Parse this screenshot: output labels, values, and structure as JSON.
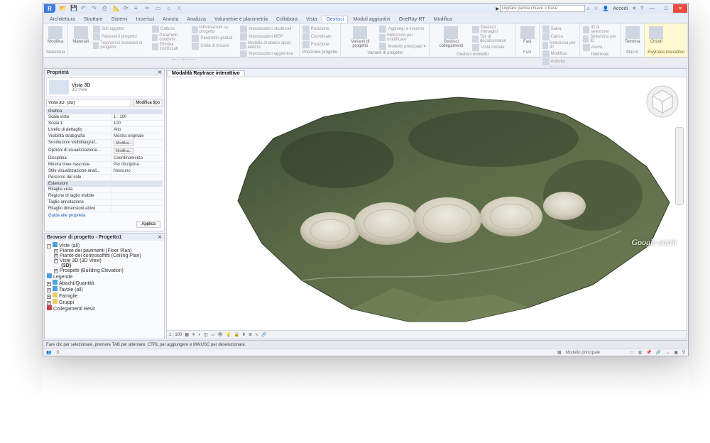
{
  "titlebar": {
    "app_icon_letter": "R",
    "search_placeholder": "Digitare parola chiave o frase",
    "signin": "Accedi",
    "window_title": ""
  },
  "qat_icons": [
    "open",
    "save",
    "undo",
    "redo",
    "print",
    "measure",
    "sync",
    "thin",
    "section",
    "3d",
    "render",
    "close"
  ],
  "tabs": [
    "Architettura",
    "Strutture",
    "Sistemi",
    "Inserisci",
    "Annota",
    "Analizza",
    "Volumetrie e planimetria",
    "Collabora",
    "Vista",
    "Gestisci",
    "Moduli aggiuntivi",
    "OneRay-RT",
    "Modifica"
  ],
  "active_tab": "Gestisci",
  "ribbon": {
    "groups": [
      {
        "label": "Seleziona",
        "big": [
          {
            "icon": "cursor",
            "label": "Modifica"
          }
        ],
        "small": []
      },
      {
        "label": "Impostazioni",
        "big": [
          {
            "icon": "materials",
            "label": "Materiali"
          }
        ],
        "small": [
          [
            "Stili oggetto",
            "Parametri progetto",
            "Trasferisci standard di progetto"
          ],
          [
            "Cattura",
            "Parametri condivisi",
            "Elimina inutilizzati"
          ],
          [
            "Informazioni su progetto",
            "Parametri globali",
            "Unità di misura"
          ],
          [
            "Impostazioni strutturali",
            "Impostazioni MEP",
            "Modello di abaco spazi elettrici",
            "Impostazioni aggiuntive"
          ]
        ]
      },
      {
        "label": "Posizione progetto",
        "big": [],
        "small": [
          [
            "Posizione",
            "Coordinate",
            "Posizione"
          ]
        ]
      },
      {
        "label": "Varianti di progetto",
        "big": [
          {
            "icon": "wrench",
            "label": "Varianti di progetto"
          }
        ],
        "small": [
          [
            "Aggiungi a insieme",
            "Seleziona per modificare",
            "Modello principale ▾"
          ]
        ]
      },
      {
        "label": "Gestisci progetto",
        "big": [
          {
            "icon": "links",
            "label": "Gestisci collegamenti"
          }
        ],
        "small": [
          [
            "Gestisci immagini",
            "Tipi di decalcomanie",
            "Vista iniziale"
          ]
        ]
      },
      {
        "label": "Fasi",
        "big": [
          {
            "icon": "phases",
            "label": "Fasi"
          }
        ]
      },
      {
        "label": "Selezione",
        "big": [],
        "small": [
          [
            "Salva",
            "Carica",
            "Seleziona per ID",
            "Modifica",
            "Annulla"
          ]
        ]
      },
      {
        "label": "Interroga",
        "big": [],
        "small": [
          [
            "ID di selezione",
            "Seleziona per ID",
            "Avvisi"
          ]
        ]
      },
      {
        "label": "Macro",
        "big": [
          {
            "icon": "stop",
            "label": "Termina"
          }
        ]
      },
      {
        "label": "Raytrace interattivo",
        "big": [
          {
            "icon": "close",
            "label": "Chiudi"
          }
        ],
        "highlight": true
      }
    ]
  },
  "properties": {
    "title": "Proprietà",
    "type_name": "Vista 3D",
    "type_sub": "3D View",
    "instance": "Vista 3D: {3D}",
    "edit_type_btn": "Modifica tipo",
    "cat_graphics": "Grafica",
    "rows_graphics": [
      {
        "k": "Scala vista",
        "v": "1 : 100"
      },
      {
        "k": "Scala  1:",
        "v": "100"
      },
      {
        "k": "Livello di dettaglio",
        "v": "Alto"
      },
      {
        "k": "Visibilità stratigrafia",
        "v": "Mostra originale"
      },
      {
        "k": "Sostituzioni visibilità/graf...",
        "v": "Modifica...",
        "btn": true
      },
      {
        "k": "Opzioni di visualizzazione...",
        "v": "Modifica...",
        "btn": true
      },
      {
        "k": "Disciplina",
        "v": "Coordinamento"
      },
      {
        "k": "Mostra linee nascoste",
        "v": "Per disciplina"
      },
      {
        "k": "Stile visualizzazione anali...",
        "v": "Nessuno"
      },
      {
        "k": "Percorso del sole",
        "v": ""
      }
    ],
    "cat_extents": "Estensioni",
    "rows_extents": [
      {
        "k": "Ritaglia vista",
        "v": ""
      },
      {
        "k": "Regione di taglio visibile",
        "v": ""
      },
      {
        "k": "Taglio annotazione",
        "v": ""
      },
      {
        "k": "Ritaglio dimensioni attivo",
        "v": ""
      }
    ],
    "help_link": "Guida alle proprietà",
    "apply": "Applica"
  },
  "browser": {
    "title": "Browser di progetto - Progetto1",
    "nodes": [
      {
        "lv": 0,
        "exp": "-",
        "t": "Viste (all)",
        "ico": "blue"
      },
      {
        "lv": 1,
        "exp": "+",
        "t": "Piante dei pavimenti (Floor Plan)"
      },
      {
        "lv": 1,
        "exp": "+",
        "t": "Piante dei controsoffitti (Ceiling Plan)"
      },
      {
        "lv": 1,
        "exp": "-",
        "t": "Viste 3D (3D View)"
      },
      {
        "lv": 2,
        "exp": "",
        "t": "{3D}",
        "bold": true
      },
      {
        "lv": 1,
        "exp": "+",
        "t": "Prospetti (Building Elevation)"
      },
      {
        "lv": 0,
        "exp": "",
        "t": "Legende",
        "ico": "blue"
      },
      {
        "lv": 0,
        "exp": "+",
        "t": "Abachi/Quantità",
        "ico": "blue"
      },
      {
        "lv": 0,
        "exp": "+",
        "t": "Tavole (all)",
        "ico": "blue"
      },
      {
        "lv": 0,
        "exp": "+",
        "t": "Famiglie",
        "ico": "yel"
      },
      {
        "lv": 0,
        "exp": "+",
        "t": "Gruppi",
        "ico": "yel"
      },
      {
        "lv": 0,
        "exp": "",
        "t": "Collegamenti Revit",
        "ico": "red"
      }
    ]
  },
  "view": {
    "tab_label": "Modalità Raytrace interattivo",
    "watermark": "Google earth",
    "controls_left": "1 : 100",
    "controls_icons": [
      "model",
      "sun",
      "shadow",
      "crop",
      "crop-region",
      "hide",
      "reveal",
      "constraints",
      "level",
      "split",
      "analytical",
      "link"
    ],
    "status_right_model": "Modello principale"
  },
  "status": {
    "hint": "Fare clic per selezionare, premere TAB per alternare, CTRL per aggiungere e MAIUSC per deselezionare."
  }
}
